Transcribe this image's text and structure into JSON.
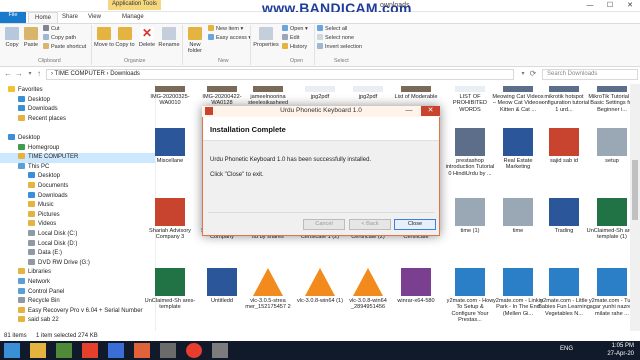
{
  "titlebar": {
    "context_tab": "Application Tools",
    "title": "ownloads",
    "watermark": "www.BANDICAM.com",
    "controls": [
      "—",
      "☐",
      "✕"
    ]
  },
  "ribbon_tabs": [
    "File",
    "Home",
    "Share",
    "View",
    "Manage"
  ],
  "ribbon": {
    "copy": "Copy",
    "paste": "Paste",
    "cut": "Cut",
    "copy_path": "Copy path",
    "paste_shortcut": "Paste shortcut",
    "move_to": "Move to",
    "copy_to": "Copy to",
    "delete": "Delete",
    "rename": "Rename",
    "new_folder": "New folder",
    "new_item": "New item ▾",
    "easy_access": "Easy access ▾",
    "properties": "Properties",
    "open": "Open ▾",
    "edit": "Edit",
    "history": "History",
    "select_all": "Select all",
    "select_none": "Select none",
    "invert_selection": "Invert selection",
    "groups": [
      "Clipboard",
      "Organize",
      "New",
      "Open",
      "Select"
    ]
  },
  "address": {
    "path": "›  TIME COMPUTER  ›  Downloads",
    "search_placeholder": "Search Downloads"
  },
  "nav": [
    {
      "label": "Favorites",
      "indent": 0,
      "color": "#f3c230"
    },
    {
      "label": "Desktop",
      "indent": 1,
      "color": "#3a8fd6"
    },
    {
      "label": "Downloads",
      "indent": 1,
      "color": "#3a8fd6"
    },
    {
      "label": "Recent places",
      "indent": 1,
      "color": "#e4b340"
    },
    {
      "label": "",
      "indent": 0,
      "color": ""
    },
    {
      "label": "Desktop",
      "indent": 0,
      "color": "#3a8fd6"
    },
    {
      "label": "Homegroup",
      "indent": 1,
      "color": "#3f9e4b"
    },
    {
      "label": "TIME COMPUTER",
      "indent": 1,
      "color": "#e4b340",
      "selected": true
    },
    {
      "label": "This PC",
      "indent": 1,
      "color": "#5a9fd6"
    },
    {
      "label": "Desktop",
      "indent": 2,
      "color": "#3a8fd6"
    },
    {
      "label": "Documents",
      "indent": 2,
      "color": "#e4b340"
    },
    {
      "label": "Downloads",
      "indent": 2,
      "color": "#3a8fd6"
    },
    {
      "label": "Music",
      "indent": 2,
      "color": "#e4b340"
    },
    {
      "label": "Pictures",
      "indent": 2,
      "color": "#e4b340"
    },
    {
      "label": "Videos",
      "indent": 2,
      "color": "#e4b340"
    },
    {
      "label": "Local Disk (C:)",
      "indent": 2,
      "color": "#8f9aa6"
    },
    {
      "label": "Local Disk (D:)",
      "indent": 2,
      "color": "#8f9aa6"
    },
    {
      "label": "Data (E:)",
      "indent": 2,
      "color": "#8f9aa6"
    },
    {
      "label": "DVD RW Drive (G:)",
      "indent": 2,
      "color": "#8f9aa6"
    },
    {
      "label": "Libraries",
      "indent": 1,
      "color": "#e4b340"
    },
    {
      "label": "Network",
      "indent": 1,
      "color": "#5a9fd6"
    },
    {
      "label": "Control Panel",
      "indent": 1,
      "color": "#5a9fd6"
    },
    {
      "label": "Recycle Bin",
      "indent": 1,
      "color": "#8f9aa6"
    },
    {
      "label": "Easy Recovery Pro v 6.04 + Serial Number",
      "indent": 1,
      "color": "#e4b340"
    },
    {
      "label": "said sab 22",
      "indent": 1,
      "color": "#e4b340"
    },
    {
      "label": "",
      "indent": 1,
      "color": ""
    }
  ],
  "files_row1": [
    "IMG-20200325-WA0010",
    "IMG-20200422-WA0128",
    "jameelnoorina steelesikasheed",
    "jpg2pdf",
    "jpg2pdf",
    "List of Moderable",
    "LIST OF PROHIBITED WORDS",
    "Meowing Cat Videos – Meow Cat Video – Kitten & Cat ...",
    "mikrotik hotspot configuration tutorial 1 urd...",
    "MikroTik Tutorial 2- Basic Settings for Beginner i..."
  ],
  "files_row2": [
    "Miscellane",
    "",
    "",
    "",
    "",
    "",
    "prestashop introduction Tutorial 0 HindiUrdu by ...",
    "Real Estate Marketing",
    "sajid sab id",
    "setup"
  ],
  "files_row3": [
    "Shariah Advisory Company 3",
    "Shariah Advisory Company",
    "ACT 2017 - Pvt Co ltd by shares",
    "Registration Certificate 1 (2)",
    "Registration Certificate (2)",
    "Registration Certificate",
    "",
    "time (1)",
    "time",
    "Trading",
    "UnClaimed-Sh ares-template (1)"
  ],
  "files_row4": [
    "UnClaimed-Sh ares-template",
    "Untitledd",
    "vlc-3.0.5-strea mer_152175457 2",
    "vlc-3.0.8-win64 (1)",
    "vlc-3.0.8-win64 _2894951456",
    "winrar-x64-580",
    "y2mate.com - How To Setup & Configure Your Prestas...",
    "y2mate.com - Linkin Park - In The End (Mellen Gi...",
    "y2mate.com - Little Babies Fun Learning Vegetables N...",
    "y2mate.com - Tum agar yunhi nazren milate rahe ..."
  ],
  "status": {
    "count": "81 items",
    "selected": "1 item selected  274 KB"
  },
  "taskbar": {
    "lang": "ENG",
    "time": "1:05 PM",
    "date": "27-Apr-20"
  },
  "dialog": {
    "title": "Urdu Phonetic Keyboard 1.0",
    "heading": "Installation Complete",
    "message": "Urdu Phonetic Keyboard 1.0 has been successfully installed.",
    "instruction": "Click \"Close\" to exit.",
    "cancel": "Cancel",
    "back": "< Back",
    "close": "Close"
  },
  "colors": {
    "file_tab": "#1979ca",
    "context_tab": "#f5d87e",
    "dialog_border": "#e0734a",
    "close_red": "#c8442e",
    "taskbar": "#111a2a",
    "selection": "#cce8ff"
  }
}
